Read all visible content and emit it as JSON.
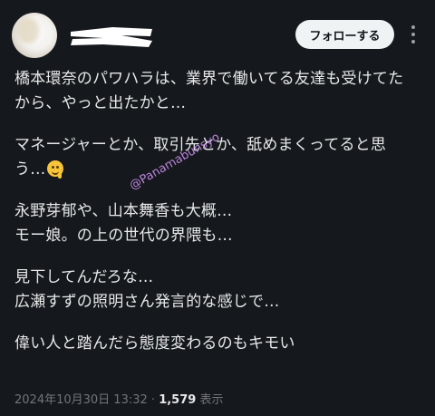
{
  "post": {
    "follow_label": "フォローする",
    "more_icon": "more-vertical-icon",
    "lines": [
      "橋本環奈のパワハラは、業界で働いてる友達も受けてた",
      "から、やっと出たかと…",
      "マネージャーとか、取引先とか、舐めまくってると思",
      "う…",
      "永野芽郁や、山本舞香も大概…",
      "モー娘。の上の世代の界隈も…",
      "見下してんだろな…",
      "広瀬すずの照明さん発言的な感じで…",
      "偉い人と踏んだら態度変わるのもキモい"
    ],
    "emoji": "melting-face-emoji",
    "watermark": "@Panamabunsyo",
    "timestamp": "2024年10月30日 13:32",
    "separator": "·",
    "views_count": "1,579",
    "views_label": "表示"
  },
  "colors": {
    "background": "#15181c",
    "text": "#e7e9ea",
    "muted": "#71767b",
    "watermark": "#c38be8",
    "follow_button_bg": "#eff3f4"
  }
}
